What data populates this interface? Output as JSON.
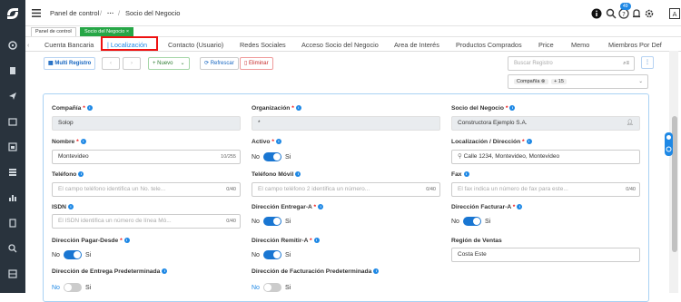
{
  "header": {
    "breadcrumb_home": "Panel de control",
    "breadcrumb_sep": "/",
    "breadcrumb_more": "···",
    "breadcrumb_current": "Socio del Negocio",
    "notification_count": "49"
  },
  "window_tabs": [
    {
      "label": "Panel de control"
    },
    {
      "label": "Socio del Negocio ×"
    }
  ],
  "subtabs": [
    {
      "label": "Cuenta Bancaria"
    },
    {
      "label": "| Localización"
    },
    {
      "label": "Contacto (Usuario)"
    },
    {
      "label": "Redes Sociales"
    },
    {
      "label": "Acceso Socio del Negocio"
    },
    {
      "label": "Area de Interés"
    },
    {
      "label": "Productos Comprados"
    },
    {
      "label": "Price"
    },
    {
      "label": "Memo"
    },
    {
      "label": "Miembros Por Def"
    }
  ],
  "toolbar": {
    "multi_registro": "Multi Registro",
    "nuevo": "Nuevo",
    "refrescar": "Refrescar",
    "eliminar": "Eliminar",
    "search_placeholder": "Buscar Registro",
    "filter_chip": "Compañía",
    "filter_more": "+ 15"
  },
  "form": {
    "compania": {
      "label": "Compañía",
      "value": "Solop"
    },
    "organizacion": {
      "label": "Organización",
      "value": "*"
    },
    "socio": {
      "label": "Socio del Negocio",
      "value": "Constructora Ejemplo S.A."
    },
    "nombre": {
      "label": "Nombre",
      "value": "Montevideo",
      "count": "10/255"
    },
    "activo": {
      "label": "Activo",
      "no": "No",
      "si": "Si"
    },
    "localizacion": {
      "label": "Localización / Dirección",
      "value": "Calle 1234, Montevideo, Montevideo"
    },
    "telefono": {
      "label": "Teléfono",
      "placeholder": "El campo teléfono identifica un No. tele...",
      "count": "0/40"
    },
    "telefono_movil": {
      "label": "Teléfono Móvil",
      "placeholder": "El campo teléfono 2 identifica un número...",
      "count": "0/40"
    },
    "fax": {
      "label": "Fax",
      "placeholder": "El fax indica un número de fax para este...",
      "count": "0/40"
    },
    "isdn": {
      "label": "ISDN",
      "placeholder": "El ISDN identifica un número de línea Mó...",
      "count": "0/40"
    },
    "dir_entregar": {
      "label": "Dirección Entregar-A",
      "no": "No",
      "si": "Si"
    },
    "dir_facturar": {
      "label": "Dirección Facturar-A",
      "no": "No",
      "si": "Si"
    },
    "dir_pagar": {
      "label": "Dirección Pagar-Desde",
      "no": "No",
      "si": "Si"
    },
    "dir_remitir": {
      "label": "Dirección Remitir-A",
      "no": "No",
      "si": "Si"
    },
    "region": {
      "label": "Región de Ventas",
      "value": "Costa Este"
    },
    "dir_entrega_pred": {
      "label": "Dirección de Entrega Predeterminada",
      "no": "No",
      "si": "Si"
    },
    "dir_fact_pred": {
      "label": "Dirección de Facturación Predeterminada",
      "no": "No",
      "si": "Si"
    }
  }
}
